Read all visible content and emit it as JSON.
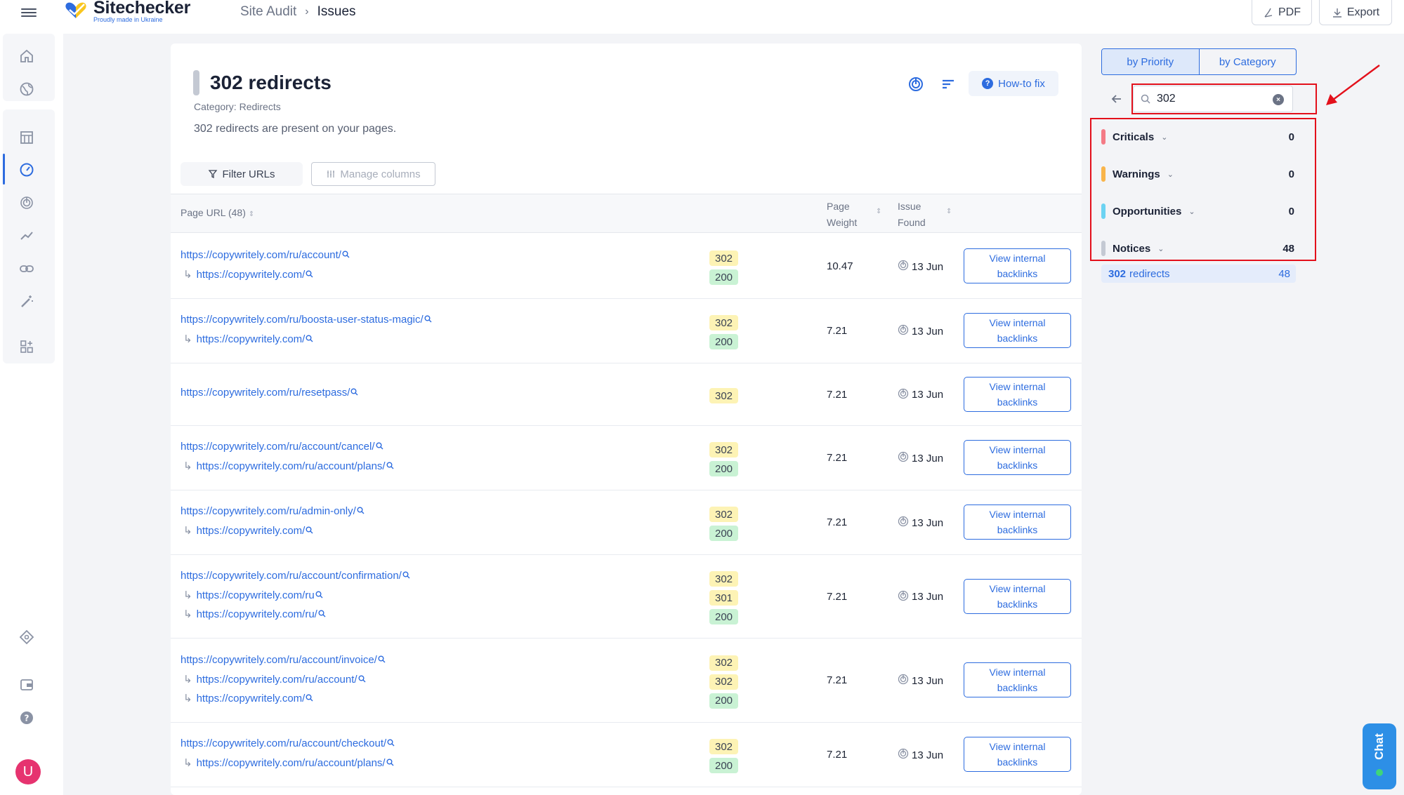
{
  "app": {
    "name": "Sitechecker",
    "tagline": "Proudly made in Ukraine"
  },
  "breadcrumb": {
    "parent": "Site Audit",
    "current": "Issues"
  },
  "toolbar": {
    "pdf_label": "PDF",
    "export_label": "Export"
  },
  "issue": {
    "title": "302 redirects",
    "category": "Category: Redirects",
    "description": "302 redirects are present on your pages.",
    "howto_label": "How-to fix"
  },
  "actions": {
    "filter_label": "Filter URLs",
    "manage_label": "Manage columns"
  },
  "table": {
    "col_url": "Page URL (48)",
    "col_weight_1": "Page",
    "col_weight_2": "Weight",
    "col_found_1": "Issue",
    "col_found_2": "Found",
    "button_line1": "View internal",
    "button_line2": "backlinks",
    "rows": [
      {
        "urls": [
          "https://copywritely.com/ru/account/",
          "https://copywritely.com/"
        ],
        "codes": [
          "302",
          "200"
        ],
        "weight": "10.47",
        "found": "13 Jun"
      },
      {
        "urls": [
          "https://copywritely.com/ru/boosta-user-status-magic/",
          "https://copywritely.com/"
        ],
        "codes": [
          "302",
          "200"
        ],
        "weight": "7.21",
        "found": "13 Jun"
      },
      {
        "urls": [
          "https://copywritely.com/ru/resetpass/"
        ],
        "codes": [
          "302"
        ],
        "weight": "7.21",
        "found": "13 Jun"
      },
      {
        "urls": [
          "https://copywritely.com/ru/account/cancel/",
          "https://copywritely.com/ru/account/plans/"
        ],
        "codes": [
          "302",
          "200"
        ],
        "weight": "7.21",
        "found": "13 Jun"
      },
      {
        "urls": [
          "https://copywritely.com/ru/admin-only/",
          "https://copywritely.com/"
        ],
        "codes": [
          "302",
          "200"
        ],
        "weight": "7.21",
        "found": "13 Jun"
      },
      {
        "urls": [
          "https://copywritely.com/ru/account/confirmation/",
          "https://copywritely.com/ru",
          "https://copywritely.com/ru/"
        ],
        "codes": [
          "302",
          "301",
          "200"
        ],
        "weight": "7.21",
        "found": "13 Jun"
      },
      {
        "urls": [
          "https://copywritely.com/ru/account/invoice/",
          "https://copywritely.com/ru/account/",
          "https://copywritely.com/"
        ],
        "codes": [
          "302",
          "302",
          "200"
        ],
        "weight": "7.21",
        "found": "13 Jun"
      },
      {
        "urls": [
          "https://copywritely.com/ru/account/checkout/",
          "https://copywritely.com/ru/account/plans/"
        ],
        "codes": [
          "302",
          "200"
        ],
        "weight": "7.21",
        "found": "13 Jun"
      }
    ]
  },
  "panel": {
    "tab_priority": "by Priority",
    "tab_category": "by Category",
    "search_value": "302",
    "groups": [
      {
        "label": "Criticals",
        "count": "0",
        "color": "#f47b86"
      },
      {
        "label": "Warnings",
        "count": "0",
        "color": "#f9b54b"
      },
      {
        "label": "Opportunities",
        "count": "0",
        "color": "#6cd3f2"
      },
      {
        "label": "Notices",
        "count": "48",
        "color": "#c4c9d3"
      }
    ],
    "result_code": "302",
    "result_label": "redirects",
    "result_count": "48"
  },
  "user": {
    "initial": "U"
  },
  "chat": {
    "label": "Chat"
  }
}
